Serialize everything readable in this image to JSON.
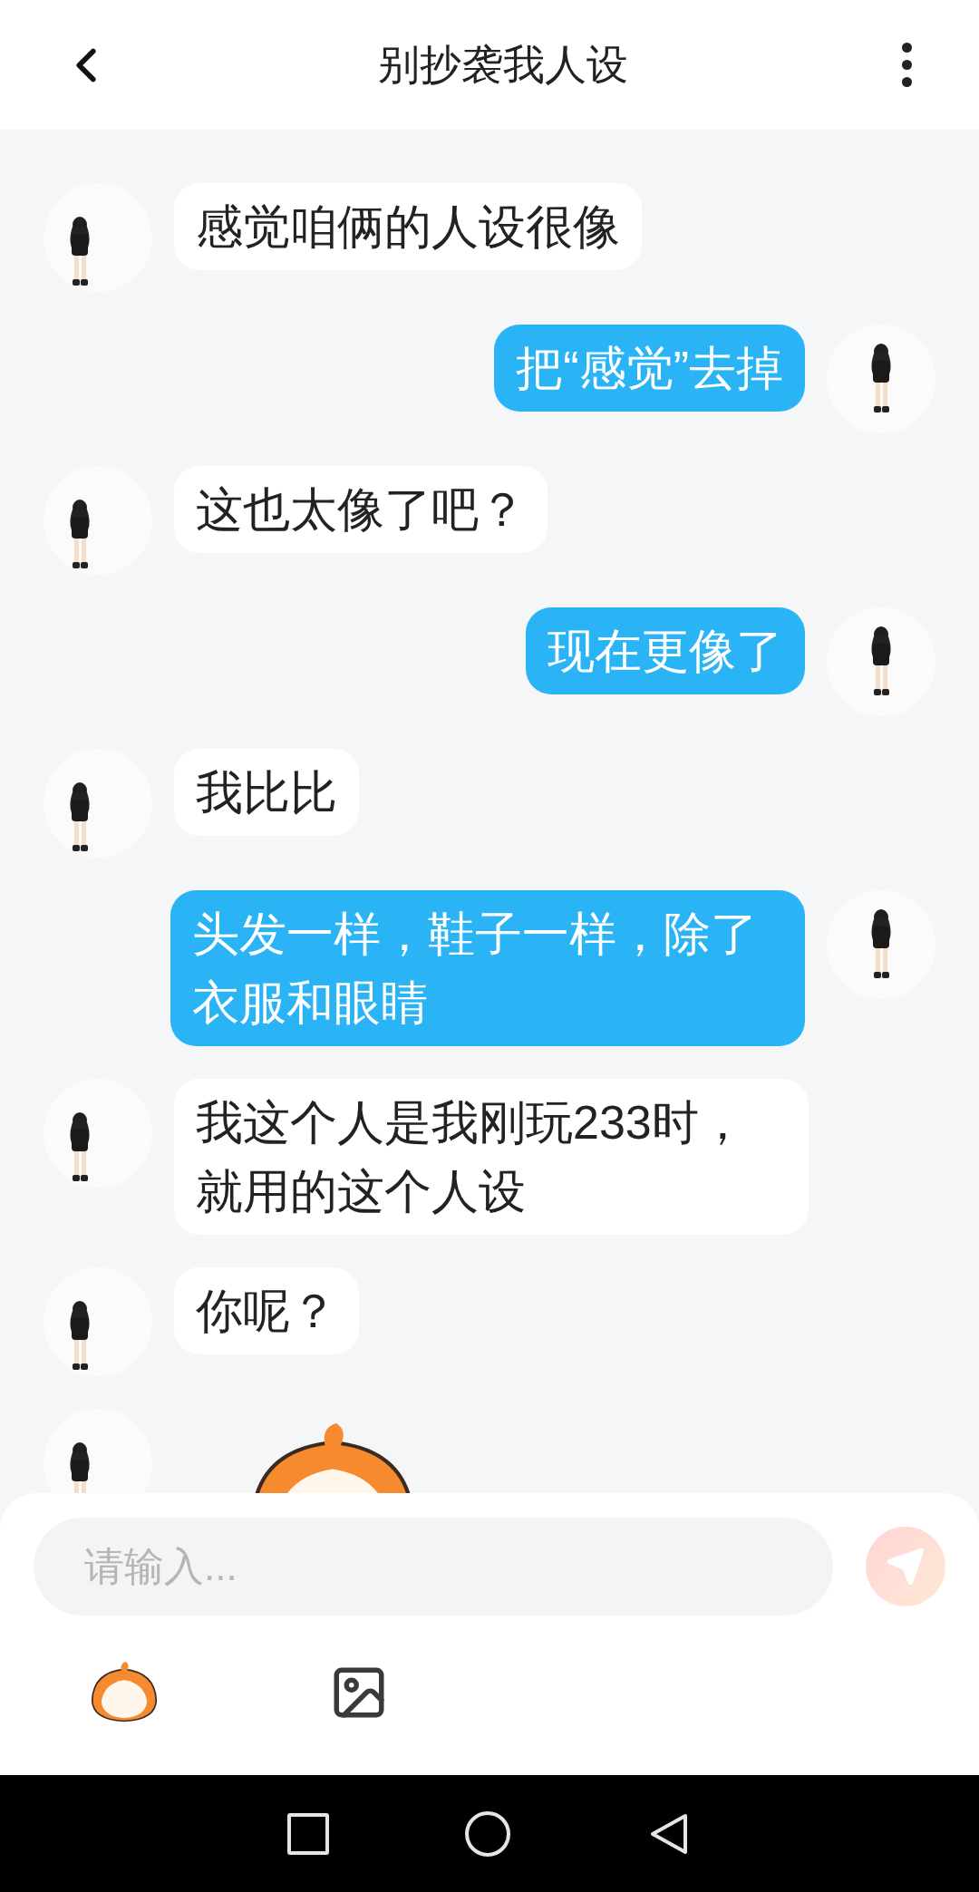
{
  "header": {
    "title": "别抄袭我人设"
  },
  "messages": [
    {
      "outgoing": false,
      "kind": "text",
      "text": "感觉咱俩的人设很像"
    },
    {
      "outgoing": true,
      "kind": "text",
      "text": "把“感觉”去掉"
    },
    {
      "outgoing": false,
      "kind": "text",
      "text": "这也太像了吧？"
    },
    {
      "outgoing": true,
      "kind": "text",
      "text": "现在更像了"
    },
    {
      "outgoing": false,
      "kind": "text",
      "text": "我比比"
    },
    {
      "outgoing": true,
      "kind": "text",
      "text": "头发一样，鞋子一样，除了衣服和眼睛"
    },
    {
      "outgoing": false,
      "kind": "text",
      "text": "我这个人是我刚玩233时，就用的这个人设"
    },
    {
      "outgoing": false,
      "kind": "text",
      "text": "你呢？"
    },
    {
      "outgoing": false,
      "kind": "sticker"
    }
  ],
  "composer": {
    "placeholder": "请输入..."
  }
}
